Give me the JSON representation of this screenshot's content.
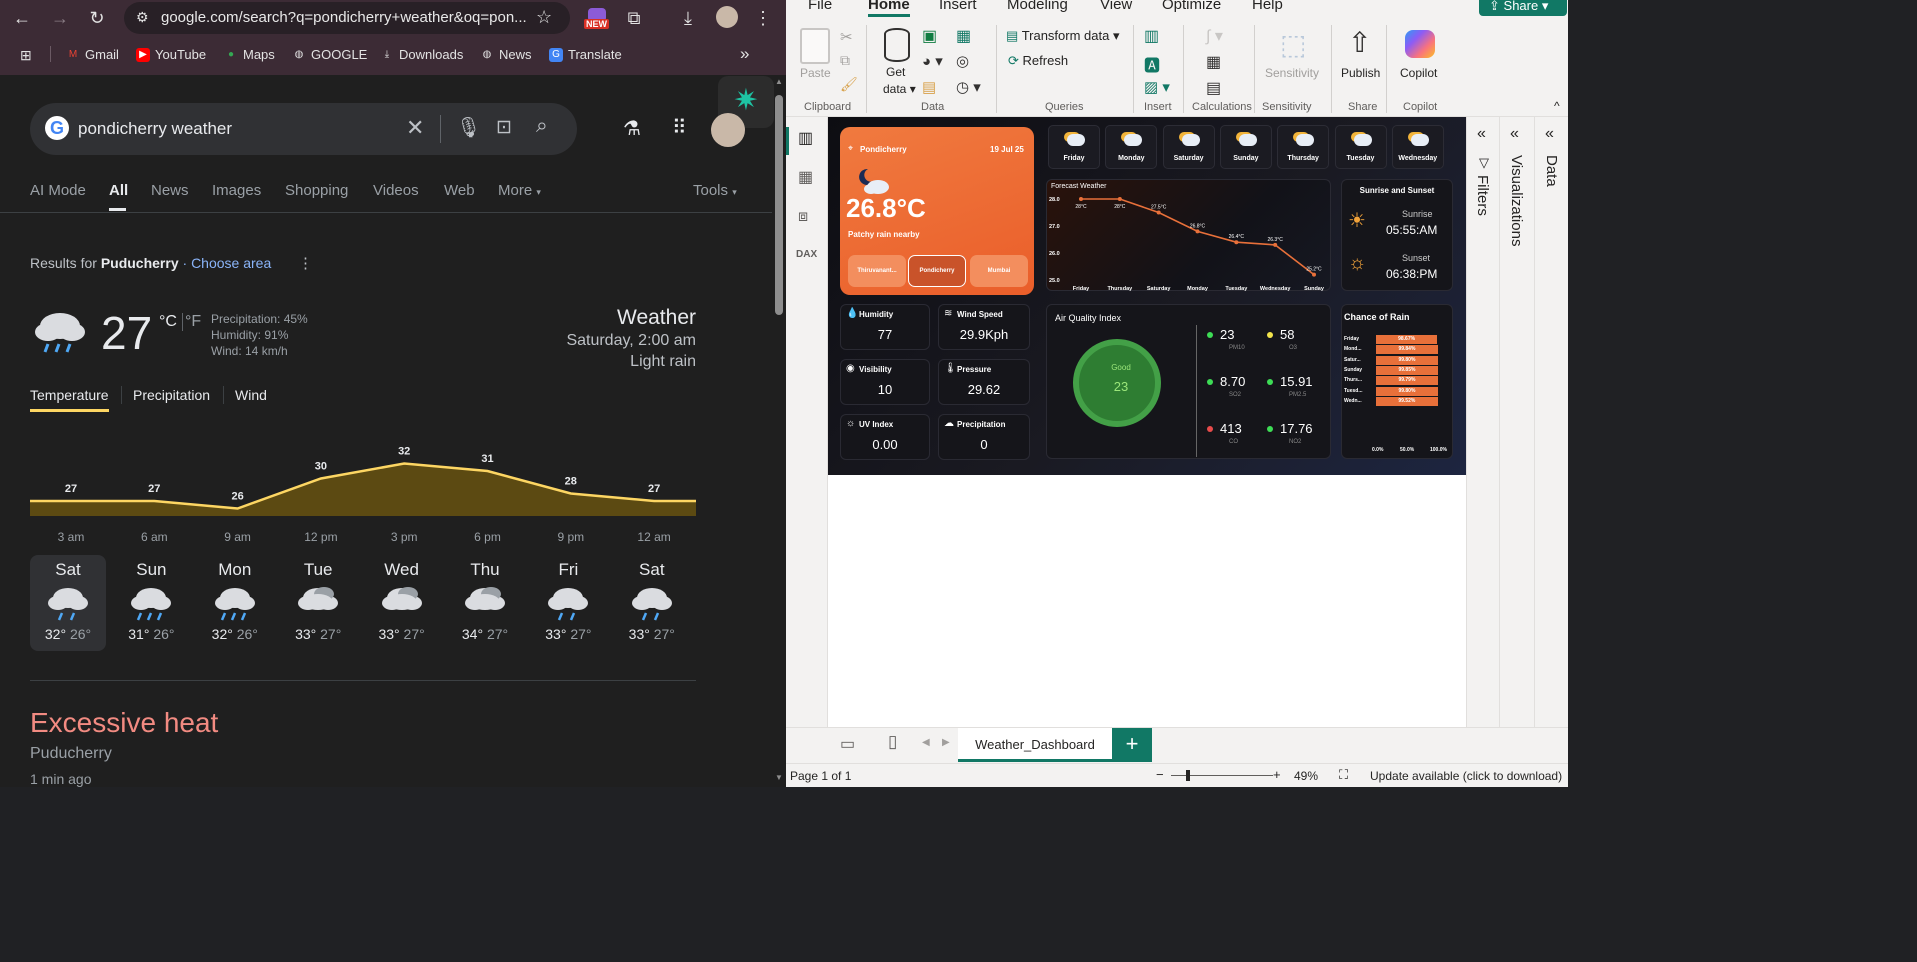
{
  "browser": {
    "url": "google.com/search?q=pondicherry+weather&oq=pon...",
    "new_badge": "NEW",
    "bookmarks": [
      "Gmail",
      "YouTube",
      "Maps",
      "GOOGLE",
      "Downloads",
      "News",
      "Translate"
    ],
    "more": "»"
  },
  "google": {
    "query": "pondicherry weather",
    "tabs": [
      "AI Mode",
      "All",
      "News",
      "Images",
      "Shopping",
      "Videos",
      "Web",
      "More"
    ],
    "tools": "Tools",
    "results_for_prefix": "Results for",
    "location": "Puducherry",
    "choose_area": "· Choose area",
    "weather": {
      "temp": "27",
      "unit_c": "°C",
      "unit_f": "°F",
      "precipitation": "Precipitation: 45%",
      "humidity": "Humidity: 91%",
      "wind": "Wind: 14 km/h",
      "title": "Weather",
      "datetime": "Saturday, 2:00 am",
      "condition": "Light rain"
    },
    "weather_tabs": [
      "Temperature",
      "Precipitation",
      "Wind"
    ],
    "hourly_labels": [
      "27",
      "27",
      "26",
      "30",
      "32",
      "31",
      "28",
      "27"
    ],
    "hourly_times": [
      "3 am",
      "6 am",
      "9 am",
      "12 pm",
      "3 pm",
      "6 pm",
      "9 pm",
      "12 am"
    ],
    "days": [
      {
        "name": "Sat",
        "icon": "rain-icon",
        "hi": "32°",
        "lo": "26°"
      },
      {
        "name": "Sun",
        "icon": "heavy-rain-icon",
        "hi": "31°",
        "lo": "26°"
      },
      {
        "name": "Mon",
        "icon": "heavy-rain-icon",
        "hi": "32°",
        "lo": "26°"
      },
      {
        "name": "Tue",
        "icon": "cloudy-icon",
        "hi": "33°",
        "lo": "27°"
      },
      {
        "name": "Wed",
        "icon": "cloudy-icon",
        "hi": "33°",
        "lo": "27°"
      },
      {
        "name": "Thu",
        "icon": "cloudy-icon",
        "hi": "34°",
        "lo": "27°"
      },
      {
        "name": "Fri",
        "icon": "rain-icon",
        "hi": "33°",
        "lo": "27°"
      },
      {
        "name": "Sat",
        "icon": "rain-icon",
        "hi": "33°",
        "lo": "27°"
      }
    ],
    "alert": {
      "title": "Excessive heat",
      "place": "Puducherry",
      "time": "1 min ago"
    }
  },
  "powerbi": {
    "menu": [
      "File",
      "Home",
      "Insert",
      "Modeling",
      "View",
      "Optimize",
      "Help"
    ],
    "share": "Share",
    "ribbon": {
      "paste": "Paste",
      "get_data": "Get",
      "get_data2": "data",
      "transform": "Transform data",
      "refresh": "Refresh",
      "sensitivity": "Sensitivity",
      "publish": "Publish",
      "copilot": "Copilot",
      "groups": [
        "Clipboard",
        "Data",
        "Queries",
        "Insert",
        "Calculations",
        "Sensitivity",
        "Share",
        "Copilot"
      ]
    },
    "panes": {
      "filters": "Filters",
      "visualizations": "Visualizations",
      "data": "Data"
    },
    "page_tab": "Weather_Dashboard",
    "status": {
      "page": "Page 1 of 1",
      "zoom": "49%",
      "update": "Update available (click to download)"
    }
  },
  "dashboard": {
    "city": "Pondicherry",
    "date": "19 Jul 25",
    "temp": "26.8°C",
    "condition": "Patchy rain nearby",
    "cities": [
      "Thiruvanant...",
      "Pondicherry",
      "Mumbai"
    ],
    "forecast_days": [
      "Friday",
      "Monday",
      "Saturday",
      "Sunday",
      "Thursday",
      "Tuesday",
      "Wednesday"
    ],
    "forecast_title": "Forecast Weather",
    "sun_title": "Sunrise and Sunset",
    "sunrise_label": "Sunrise",
    "sunrise": "05:55:AM",
    "sunset_label": "Sunset",
    "sunset": "06:38:PM",
    "metrics": [
      {
        "label": "Humidity",
        "value": "77"
      },
      {
        "label": "Wind Speed",
        "value": "29.9Kph"
      },
      {
        "label": "Visibility",
        "value": "10"
      },
      {
        "label": "Pressure",
        "value": "29.62"
      },
      {
        "label": "UV Index",
        "value": "0.00"
      },
      {
        "label": "Precipitation",
        "value": "0"
      }
    ],
    "aqi_title": "Air Quality Index",
    "aqi_status": "Good",
    "aqi_value": "23",
    "aqi_items": [
      {
        "value": "23",
        "name": "PM10",
        "color": "#3ddc55"
      },
      {
        "value": "58",
        "name": "O3",
        "color": "#f2e34b"
      },
      {
        "value": "8.70",
        "name": "SO2",
        "color": "#3ddc55"
      },
      {
        "value": "15.91",
        "name": "PM2.5",
        "color": "#3ddc55"
      },
      {
        "value": "413",
        "name": "CO",
        "color": "#e84b4b"
      },
      {
        "value": "17.76",
        "name": "NO2",
        "color": "#3ddc55"
      }
    ],
    "rain_title": "Chance of Rain",
    "rain_axis": [
      "0.0%",
      "50.0%",
      "100.0%"
    ]
  },
  "chart_data": [
    {
      "type": "area",
      "title": "",
      "categories": [
        "3 am",
        "6 am",
        "9 am",
        "12 pm",
        "3 pm",
        "6 pm",
        "9 pm",
        "12 am"
      ],
      "series": [
        {
          "values": [
            27,
            27,
            26,
            30,
            32,
            31,
            28,
            27
          ]
        }
      ],
      "accent": "#fdd663"
    },
    {
      "type": "line",
      "title": "Forecast Weather",
      "categories": [
        "Friday",
        "Thursday",
        "Saturday",
        "Monday",
        "Tuesday",
        "Wednesday",
        "Sunday"
      ],
      "series": [
        {
          "values": [
            28.0,
            28.0,
            27.5,
            26.8,
            26.4,
            26.3,
            25.2
          ]
        }
      ],
      "data_labels": [
        "28°C",
        "28°C",
        "27.5°C",
        "26.8°C",
        "26.4°C",
        "26.3°C",
        "25.2°C"
      ],
      "y_ticks": [
        "28.0",
        "27.0",
        "26.0",
        "25.0"
      ],
      "ylim": [
        25,
        28
      ],
      "accent": "#e8703a"
    },
    {
      "type": "bar",
      "title": "Chance of Rain",
      "categories": [
        "Friday",
        "Mond...",
        "Satur...",
        "Sunday",
        "Thurs...",
        "Tuesd...",
        "Wedn..."
      ],
      "values": [
        98.67,
        99.84,
        99.8,
        99.85,
        99.79,
        99.8,
        99.52
      ],
      "data_labels": [
        "98.67%",
        "99.84%",
        "99.80%",
        "99.85%",
        "99.79%",
        "99.80%",
        "99.52%"
      ],
      "xlim": [
        0,
        100
      ],
      "accent": "#e8703a"
    }
  ]
}
